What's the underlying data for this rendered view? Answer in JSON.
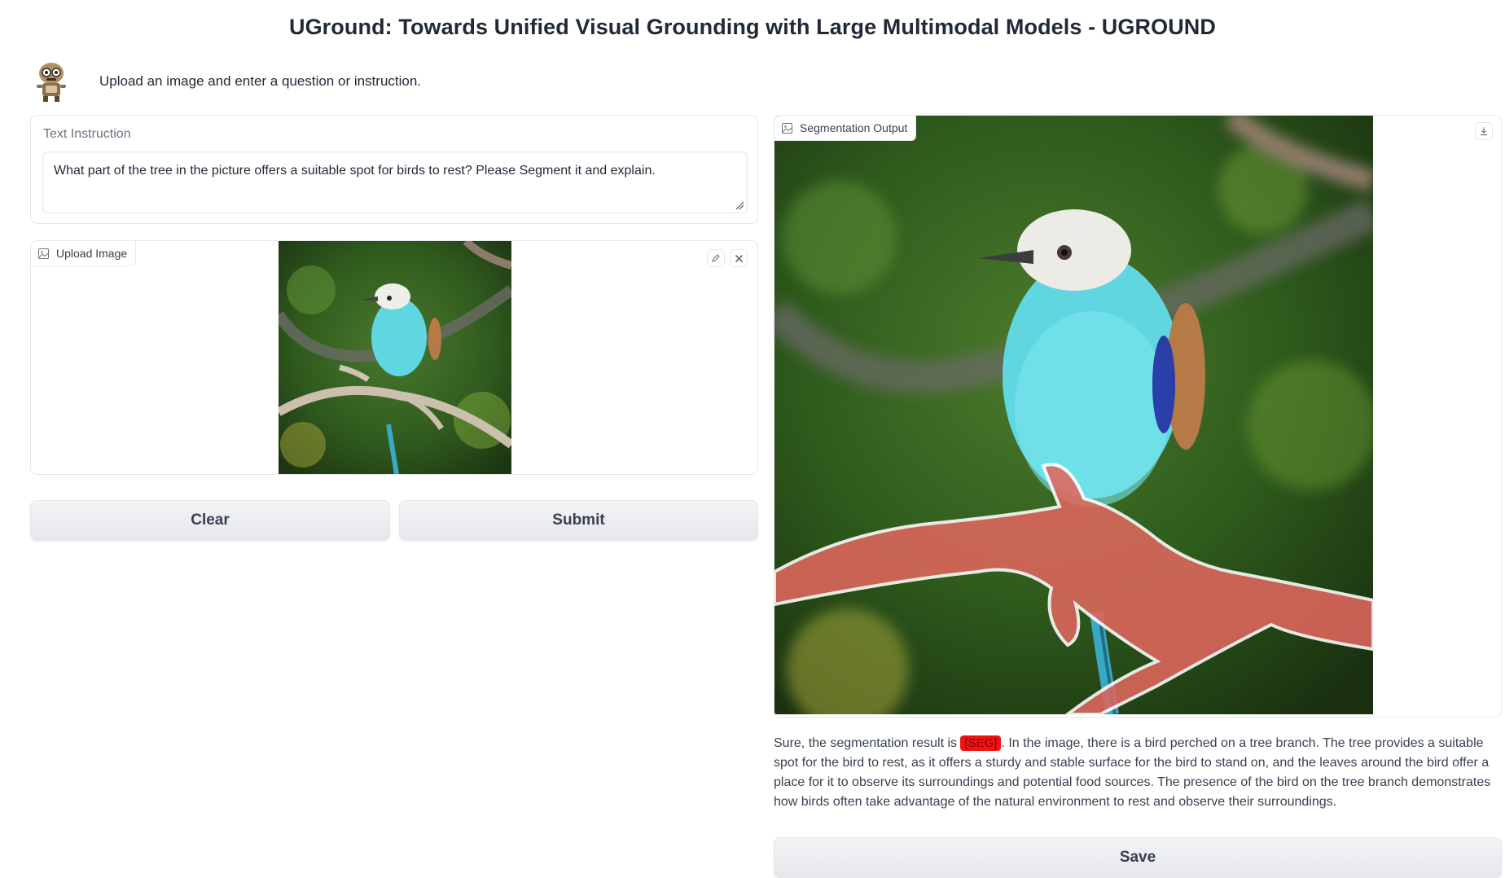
{
  "page": {
    "title": "UGround: Towards Unified Visual Grounding with Large Multimodal Models - UGROUND",
    "description": "Upload an image and enter a question or instruction."
  },
  "text_instruction": {
    "label": "Text Instruction",
    "value": "What part of the tree in the picture offers a suitable spot for birds to rest?  Please Segment it and explain."
  },
  "upload_image": {
    "label": "Upload Image",
    "edit_icon": "pencil-icon",
    "close_icon": "close-icon"
  },
  "buttons": {
    "clear": "Clear",
    "submit": "Submit",
    "save": "Save"
  },
  "segmentation_output": {
    "label": "Segmentation Output",
    "download_icon": "download-icon"
  },
  "answer": {
    "prefix": "Sure, the segmentation result is ",
    "seg_token": "[SEG]",
    "suffix": ". In the image, there is a bird perched on a tree branch. The tree provides a suitable spot for the bird to rest, as it offers a sturdy and stable surface for the bird to stand on, and the leaves around the bird offer a place for it to observe its surroundings and potential food sources. The presence of the bird on the tree branch demonstrates how birds often take advantage of the natural environment to rest and observe their surroundings."
  },
  "colors": {
    "seg_highlight": "#ef1414",
    "mask_overlay": "#e0675e",
    "bird_body": "#5fd6e0"
  }
}
